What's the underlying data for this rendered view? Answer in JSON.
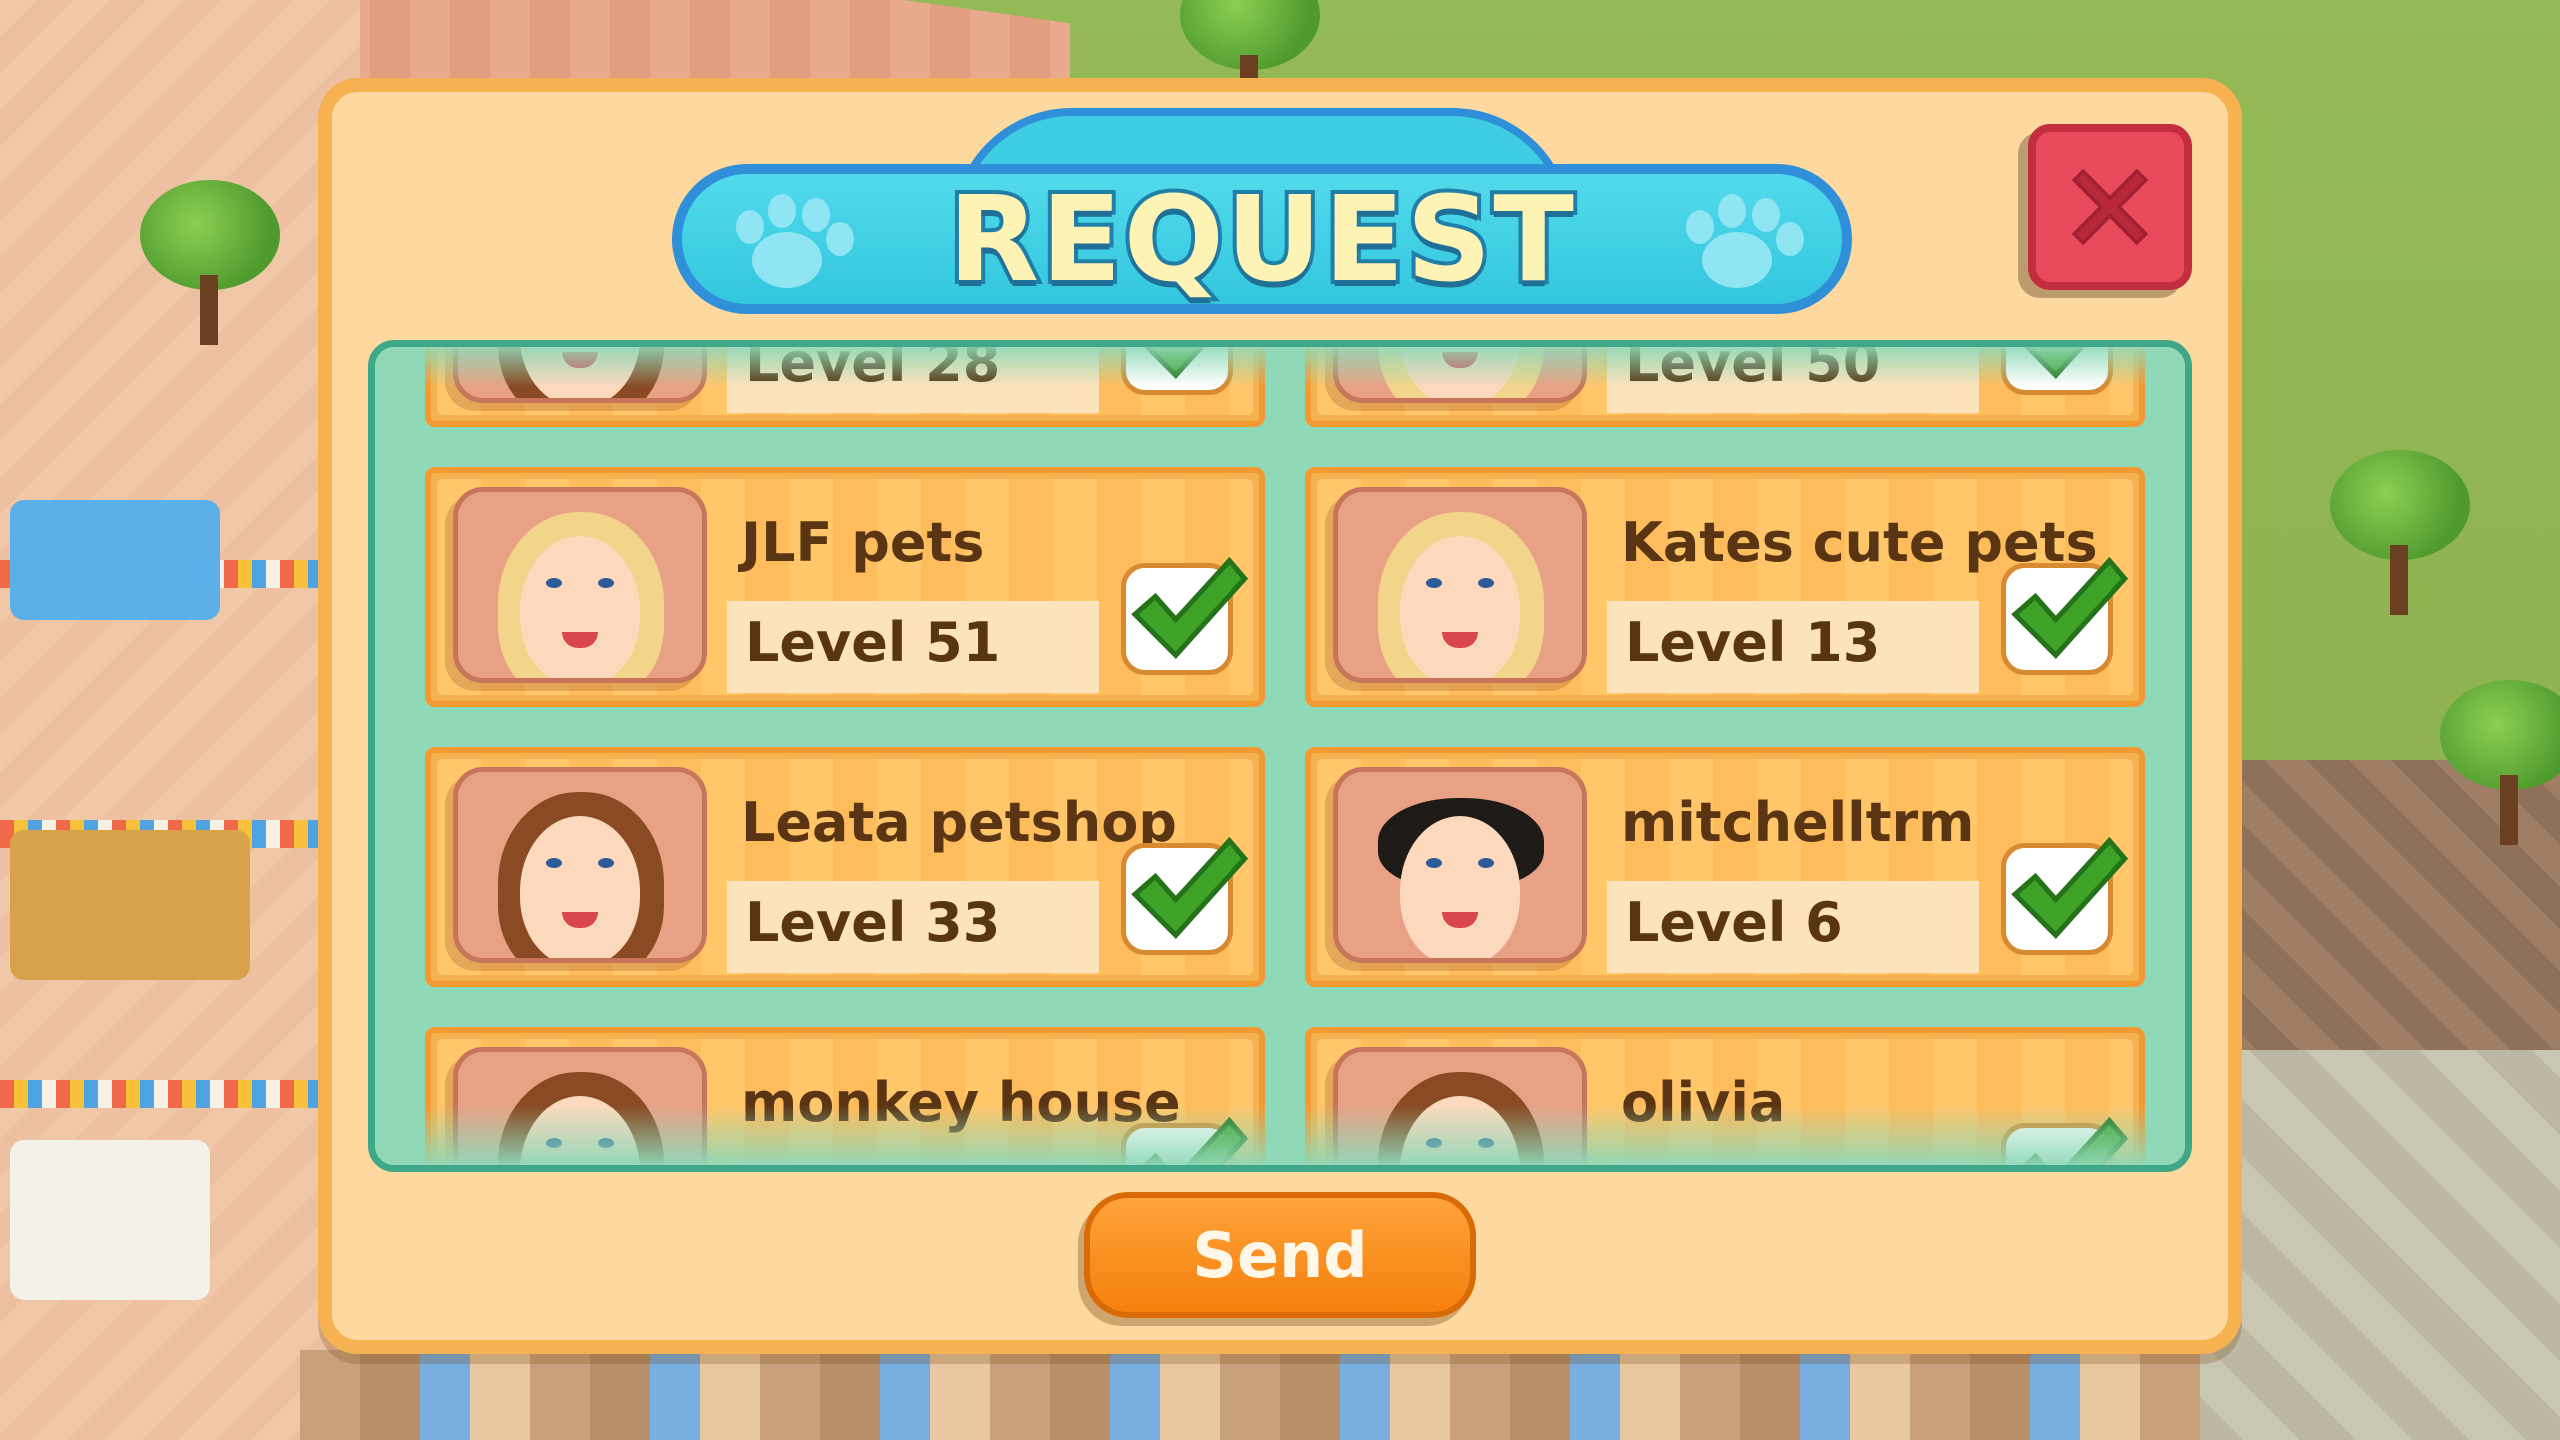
{
  "dialog": {
    "title": "REQUEST",
    "send_label": "Send"
  },
  "colors": {
    "panel": "#fdd9a0",
    "panel_border": "#f6b150",
    "title_banner": "#3fcde3",
    "list_bg": "#8fd8b8",
    "card": "#ffc66a",
    "check": "#3fa328",
    "close": "#e84a5b",
    "send": "#f68d14",
    "text": "#5a3513"
  },
  "friends": [
    {
      "name": "",
      "level": "Level 28",
      "avatar": "brunette-woman-avatar",
      "selected": true
    },
    {
      "name": "",
      "level": "Level 50",
      "avatar": "blonde-woman-avatar",
      "selected": true
    },
    {
      "name": "JLF pets",
      "level": "Level 51",
      "avatar": "blonde-woman-avatar",
      "selected": true
    },
    {
      "name": "Kates cute pets",
      "level": "Level 13",
      "avatar": "blonde-woman-avatar",
      "selected": true
    },
    {
      "name": "Leata petshop",
      "level": "Level 33",
      "avatar": "brunette-woman-avatar",
      "selected": true
    },
    {
      "name": "mitchelltrm",
      "level": "Level 6",
      "avatar": "man-avatar",
      "selected": true
    },
    {
      "name": "monkey house",
      "level": "",
      "avatar": "brunette-woman-avatar",
      "selected": true
    },
    {
      "name": "olivia",
      "level": "",
      "avatar": "brunette-woman-avatar",
      "selected": true
    }
  ]
}
